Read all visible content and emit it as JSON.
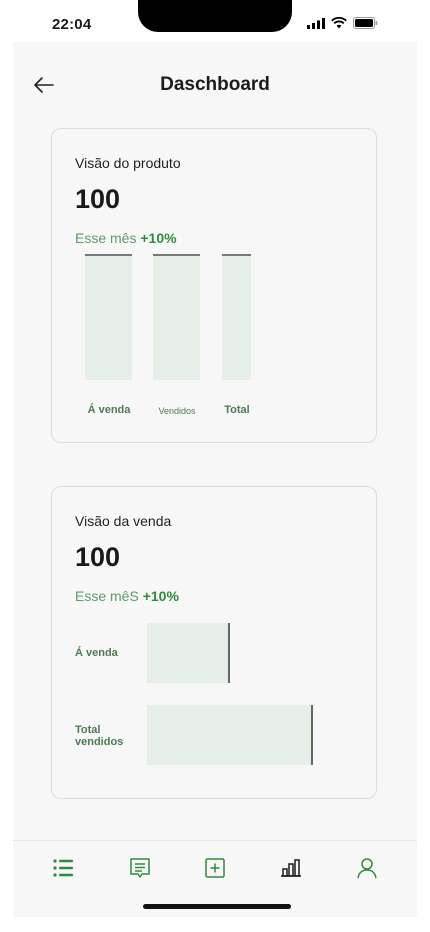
{
  "status_bar": {
    "time": "22:04"
  },
  "header": {
    "title": "Daschboard",
    "back_icon": "arrow-left-icon"
  },
  "product_card": {
    "title": "Visão do produto",
    "value": "100",
    "period_label": "Esse mês",
    "delta": "+10%",
    "bars": [
      {
        "label": "Á venda",
        "level": 1.0
      },
      {
        "label": "Vendidos",
        "level": 1.0
      },
      {
        "label": "Total",
        "level": 1.0
      }
    ]
  },
  "sales_card": {
    "title": "Visão da venda",
    "value": "100",
    "period_label": "Esse mêS",
    "delta": "+10%",
    "bars": [
      {
        "label": "Á venda",
        "level": 0.5
      },
      {
        "label": "Total vendidos",
        "level": 1.0
      }
    ]
  },
  "tab_bar": {
    "items": [
      {
        "icon": "list-icon",
        "active": true
      },
      {
        "icon": "receipt-icon",
        "active": false
      },
      {
        "icon": "add-square-icon",
        "active": false
      },
      {
        "icon": "chart-icon",
        "active": false
      },
      {
        "icon": "user-icon",
        "active": false
      }
    ]
  },
  "colors": {
    "accent_green": "#2e8b3e",
    "bar_fill": "#e6efe7",
    "label_green": "#4d7a55"
  }
}
